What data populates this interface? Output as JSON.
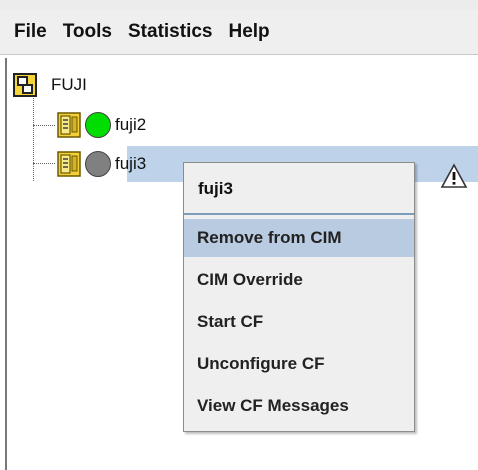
{
  "menu": [
    "File",
    "Tools",
    "Statistics",
    "Help"
  ],
  "tree": {
    "root": {
      "label": "FUJI",
      "icon": "cluster-icon"
    },
    "nodes": [
      {
        "label": "fuji2",
        "status": "online",
        "status_color": "#00dd00"
      },
      {
        "label": "fuji3",
        "status": "unknown",
        "status_color": "#808080",
        "selected": true
      }
    ]
  },
  "context_menu": {
    "title": "fuji3",
    "items": [
      {
        "label": "Remove from CIM",
        "highlighted": true
      },
      {
        "label": "CIM Override"
      },
      {
        "label": "Start CF"
      },
      {
        "label": "Unconfigure CF"
      },
      {
        "label": "View CF Messages"
      }
    ]
  },
  "colors": {
    "selection": "#bed2ea",
    "menu_highlight": "#b9cbe0",
    "online": "#00dd00",
    "offline": "#808080"
  }
}
